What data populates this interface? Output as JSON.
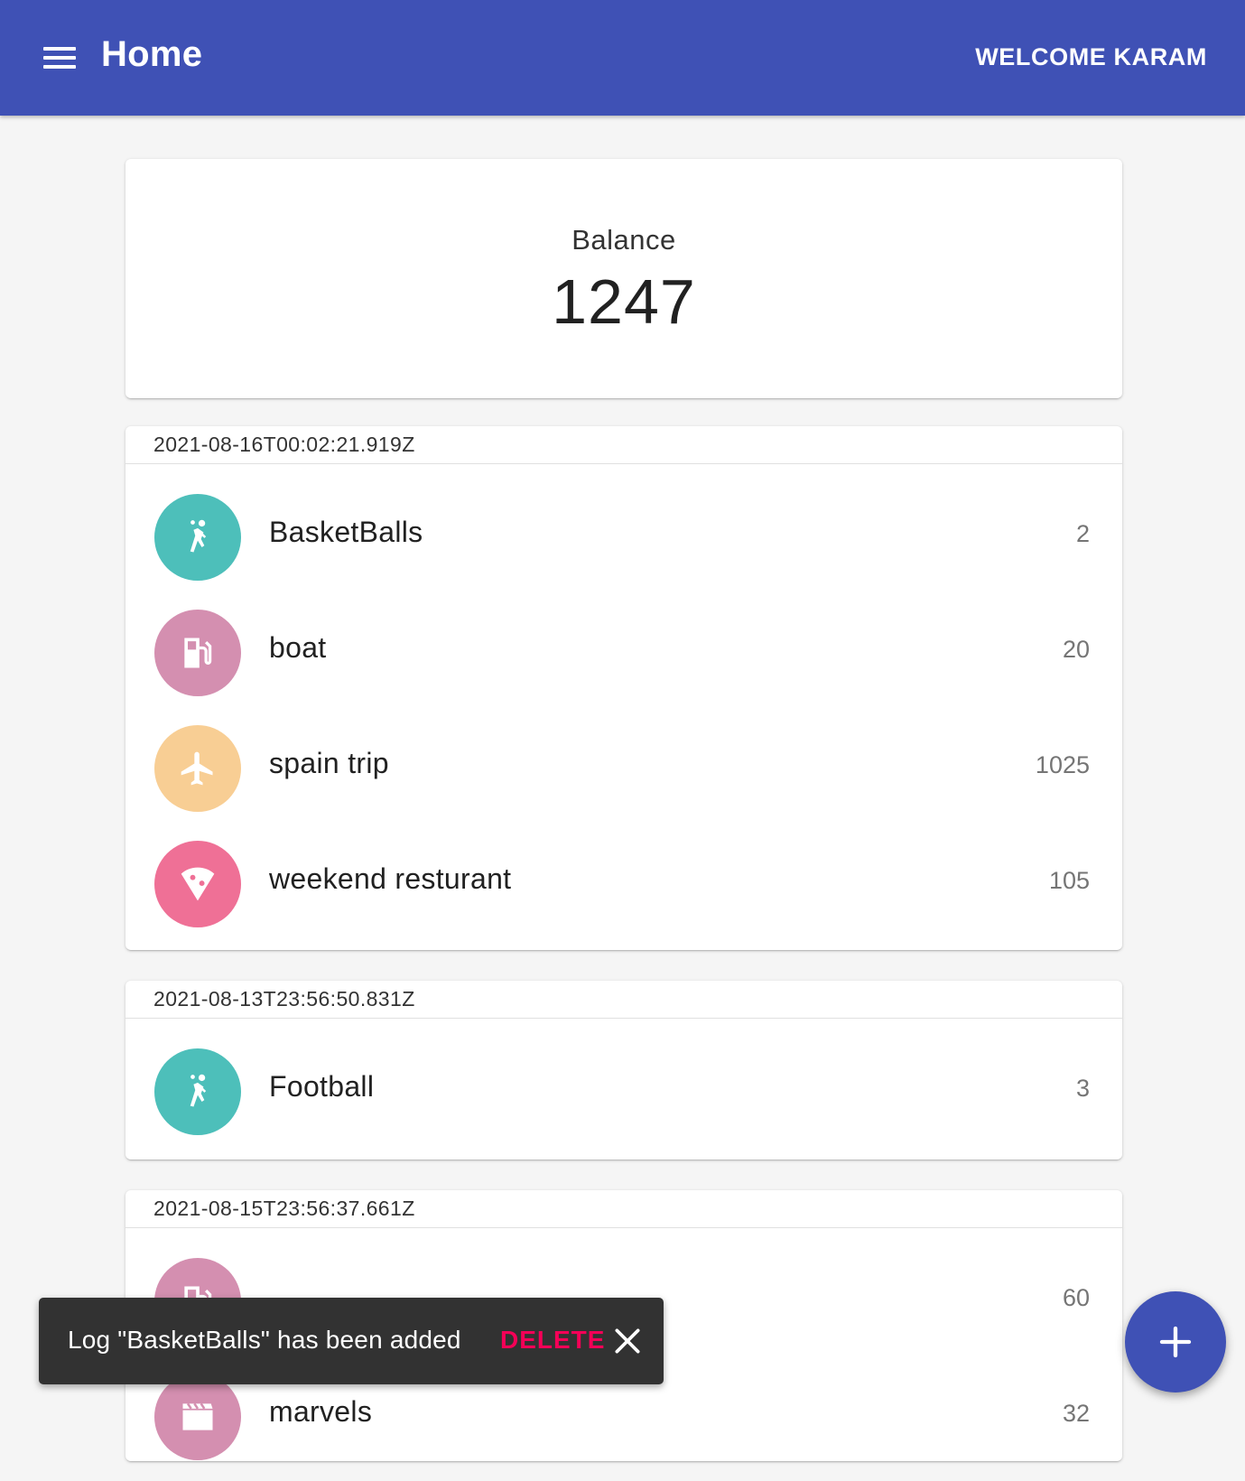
{
  "header": {
    "title": "Home",
    "welcome": "WELCOME KARAM",
    "menu_icon": "menu-icon",
    "background": "#3f51b5"
  },
  "balance": {
    "label": "Balance",
    "amount": "1247"
  },
  "logs": [
    {
      "date": "2021-08-16T00:02:21.919Z",
      "items": [
        {
          "name": "BasketBalls",
          "value": "2",
          "icon": "sports-icon",
          "color": "#4dbfba"
        },
        {
          "name": "boat",
          "value": "20",
          "icon": "fuel-icon",
          "color": "#d48fb0"
        },
        {
          "name": "spain trip",
          "value": "1025",
          "icon": "airplane-icon",
          "color": "#f8ce94"
        },
        {
          "name": "weekend resturant",
          "value": "105",
          "icon": "pizza-icon",
          "color": "#ef7096"
        }
      ]
    },
    {
      "date": "2021-08-13T23:56:50.831Z",
      "items": [
        {
          "name": "Football",
          "value": "3",
          "icon": "sports-icon",
          "color": "#4dbfba"
        }
      ]
    },
    {
      "date": "2021-08-15T23:56:37.661Z",
      "items": [
        {
          "name": "",
          "value": "60",
          "icon": "fuel-icon",
          "color": "#d48fb0"
        },
        {
          "name": "marvels",
          "value": "32",
          "icon": "movie-icon",
          "color": "#d48fb0"
        }
      ]
    }
  ],
  "snackbar": {
    "message": "Log \"BasketBalls\" has been added",
    "action": "DELETE",
    "action_color": "#f50057",
    "close_icon": "close-icon"
  },
  "fab": {
    "icon": "plus-icon"
  }
}
